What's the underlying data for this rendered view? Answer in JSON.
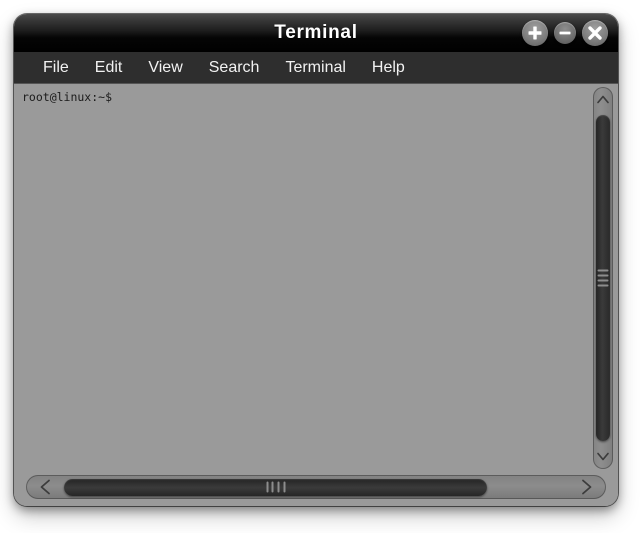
{
  "window": {
    "title": "Terminal",
    "controls": [
      {
        "name": "maximize-button",
        "icon": "plus-icon",
        "symbol": "+"
      },
      {
        "name": "minimize-button",
        "icon": "minus-icon",
        "symbol": "−"
      },
      {
        "name": "close-button",
        "icon": "close-icon",
        "symbol": "×"
      }
    ]
  },
  "menubar": {
    "items": [
      {
        "label": "File"
      },
      {
        "label": "Edit"
      },
      {
        "label": "View"
      },
      {
        "label": "Search"
      },
      {
        "label": "Terminal"
      },
      {
        "label": "Help"
      }
    ]
  },
  "terminal": {
    "prompt": "root@linux:~$",
    "background_color": "#9a9a9a",
    "text_color": "#1b1b1b"
  },
  "scrollbars": {
    "vertical": {
      "up_arrow_icon": "chevron-up-icon",
      "down_arrow_icon": "chevron-down-icon",
      "grip_lines": 4
    },
    "horizontal": {
      "left_arrow_icon": "chevron-left-icon",
      "right_arrow_icon": "chevron-right-icon",
      "grip_lines": 4
    }
  },
  "colors": {
    "titlebar": "#000000",
    "menubar": "#2e2e2e",
    "chrome": "#9a9a9a",
    "thumb": "#2c2c2c"
  }
}
